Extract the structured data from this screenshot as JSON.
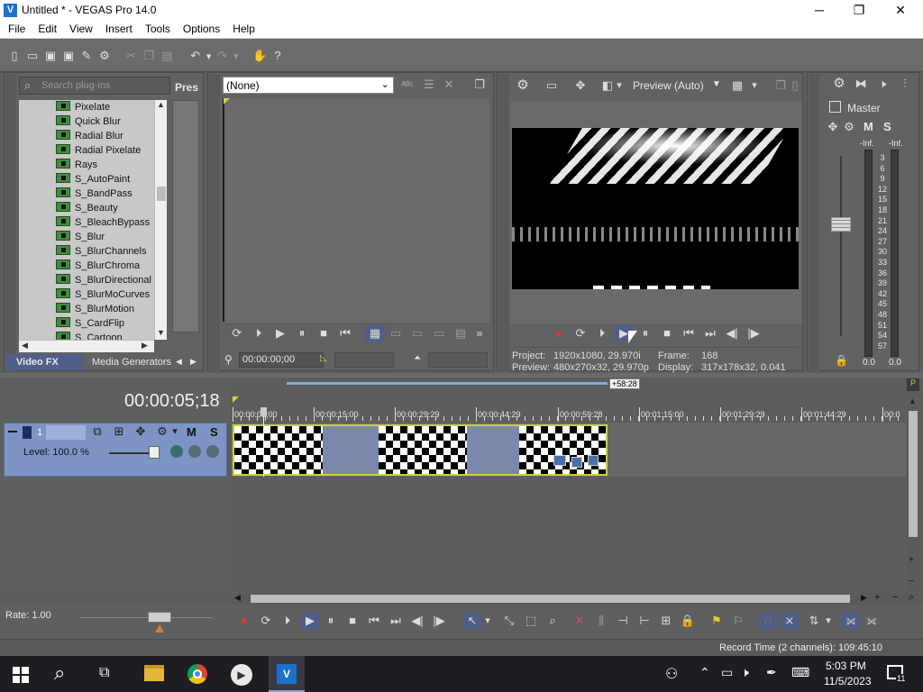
{
  "window": {
    "title": "Untitled * - VEGAS Pro 14.0",
    "minimize": "─",
    "maximize": "❐",
    "close": "✕"
  },
  "menu": [
    "File",
    "Edit",
    "View",
    "Insert",
    "Tools",
    "Options",
    "Help"
  ],
  "plugins": {
    "search_placeholder": "Search plug-ins",
    "presets_label": "Pres",
    "items": [
      "Pixelate",
      "Quick Blur",
      "Radial Blur",
      "Radial Pixelate",
      "Rays",
      "S_AutoPaint",
      "S_BandPass",
      "S_Beauty",
      "S_BleachBypass",
      "S_Blur",
      "S_BlurChannels",
      "S_BlurChroma",
      "S_BlurDirectional",
      "S_BlurMoCurves",
      "S_BlurMotion",
      "S_CardFlip",
      "S_Cartoon"
    ],
    "tabs": [
      "Video FX",
      "Media Generators"
    ]
  },
  "trimmer": {
    "dropdown_value": "(None)",
    "timecode": "00:00:00;00"
  },
  "preview": {
    "quality": "Preview (Auto)",
    "project_label": "Project:",
    "project_value": "1920x1080, 29.970i",
    "frame_label": "Frame:",
    "frame_value": "168",
    "preview_label": "Preview:",
    "preview_value": "480x270x32, 29.970p",
    "display_label": "Display:",
    "display_value": "317x178x32, 0.041"
  },
  "mixer": {
    "master_label": "Master",
    "m_label": "M",
    "s_label": "S",
    "inf_left": "-Inf.",
    "inf_right": "-Inf.",
    "scale": [
      "3",
      "6",
      "9",
      "12",
      "15",
      "18",
      "21",
      "24",
      "27",
      "30",
      "33",
      "36",
      "39",
      "42",
      "45",
      "48",
      "51",
      "54",
      "57"
    ],
    "bottom_left": "0.0",
    "bottom_right": "0.0"
  },
  "timeline": {
    "timecode": "00:00:05;18",
    "loop_badge": "+58:28",
    "ruler": [
      "00:00:00;00",
      "00:00:15:00",
      "00:00:29:29",
      "00:00:44:29",
      "00:00:59:28",
      "00:01:15:00",
      "00:01:29:29",
      "00:01:44:29",
      "00:0"
    ],
    "track_number": "1",
    "track_m": "M",
    "track_s": "S",
    "level": "Level: 100.0 %",
    "rate": "Rate: 1.00",
    "record_time": "Record Time (2 channels): 109:45:10"
  },
  "taskbar": {
    "time": "5:03 PM",
    "date": "11/5/2023",
    "notif_count": "11"
  }
}
